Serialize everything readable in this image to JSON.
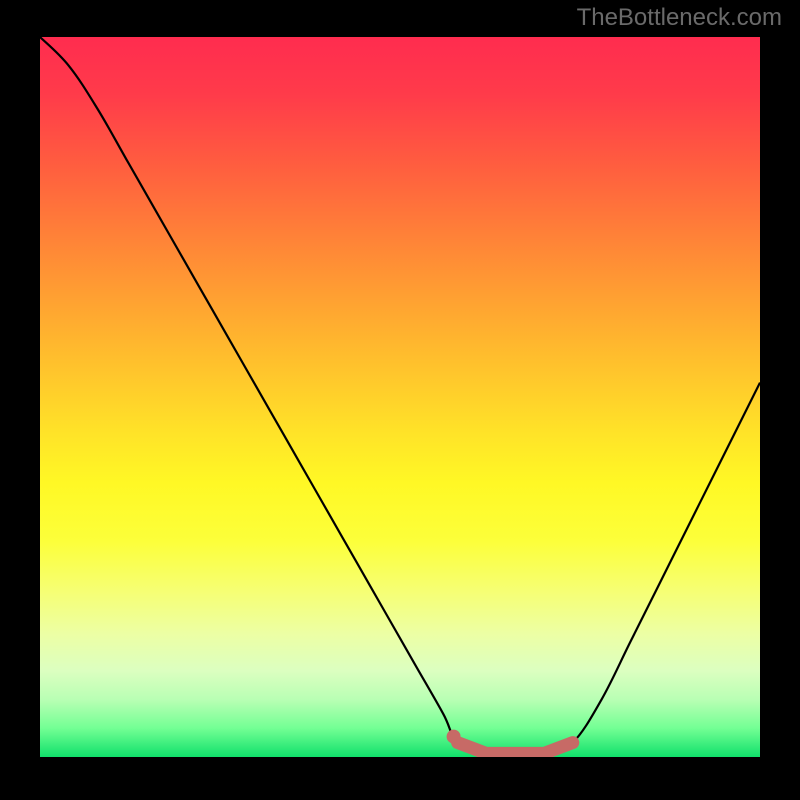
{
  "watermark": "TheBottleneck.com",
  "chart_data": {
    "type": "line",
    "title": "",
    "xlabel": "",
    "ylabel": "",
    "xlim": [
      0,
      100
    ],
    "ylim": [
      0,
      100
    ],
    "grid": false,
    "series": [
      {
        "name": "bottleneck-curve",
        "x": [
          0,
          4,
          8,
          12,
          16,
          20,
          24,
          28,
          32,
          36,
          40,
          44,
          48,
          52,
          56,
          58,
          62,
          66,
          70,
          74,
          78,
          82,
          86,
          90,
          94,
          100
        ],
        "values": [
          100,
          96,
          90,
          83,
          76,
          69,
          62,
          55,
          48,
          41,
          34,
          27,
          20,
          13,
          6,
          2,
          0,
          0,
          0,
          2,
          8,
          16,
          24,
          32,
          40,
          52
        ]
      }
    ],
    "markers": {
      "name": "optimal-range",
      "color": "#c76a66",
      "points": [
        {
          "x": 58,
          "y": 2
        },
        {
          "x": 62,
          "y": 0.5
        },
        {
          "x": 66,
          "y": 0.5
        },
        {
          "x": 70,
          "y": 0.5
        },
        {
          "x": 74,
          "y": 2
        }
      ]
    },
    "background_gradient": {
      "top": "#ff2c4f",
      "mid": "#ffe328",
      "bottom": "#10e06b"
    }
  }
}
